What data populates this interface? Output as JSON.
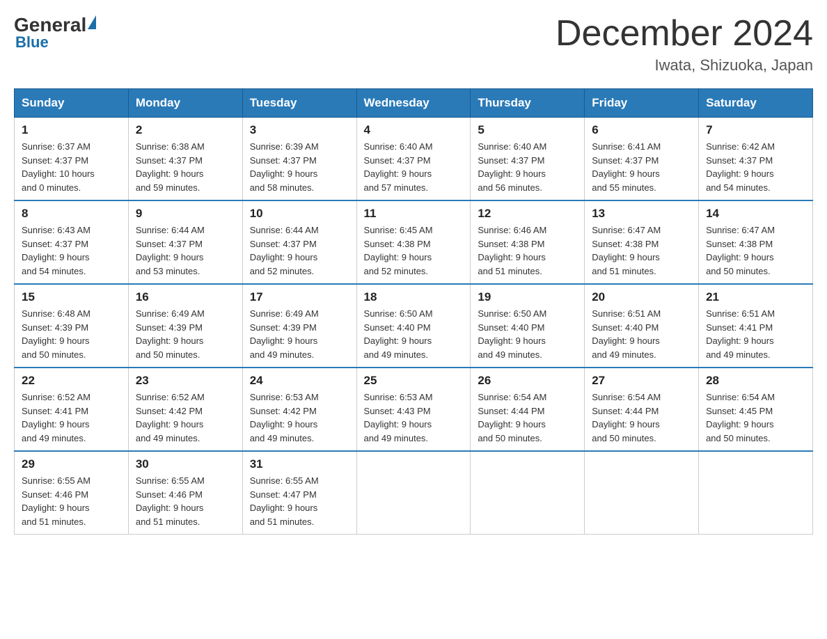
{
  "header": {
    "logo_general": "General",
    "logo_blue": "Blue",
    "title": "December 2024",
    "subtitle": "Iwata, Shizuoka, Japan"
  },
  "days_of_week": [
    "Sunday",
    "Monday",
    "Tuesday",
    "Wednesday",
    "Thursday",
    "Friday",
    "Saturday"
  ],
  "weeks": [
    [
      {
        "day": "1",
        "sunrise": "6:37 AM",
        "sunset": "4:37 PM",
        "daylight": "10 hours and 0 minutes."
      },
      {
        "day": "2",
        "sunrise": "6:38 AM",
        "sunset": "4:37 PM",
        "daylight": "9 hours and 59 minutes."
      },
      {
        "day": "3",
        "sunrise": "6:39 AM",
        "sunset": "4:37 PM",
        "daylight": "9 hours and 58 minutes."
      },
      {
        "day": "4",
        "sunrise": "6:40 AM",
        "sunset": "4:37 PM",
        "daylight": "9 hours and 57 minutes."
      },
      {
        "day": "5",
        "sunrise": "6:40 AM",
        "sunset": "4:37 PM",
        "daylight": "9 hours and 56 minutes."
      },
      {
        "day": "6",
        "sunrise": "6:41 AM",
        "sunset": "4:37 PM",
        "daylight": "9 hours and 55 minutes."
      },
      {
        "day": "7",
        "sunrise": "6:42 AM",
        "sunset": "4:37 PM",
        "daylight": "9 hours and 54 minutes."
      }
    ],
    [
      {
        "day": "8",
        "sunrise": "6:43 AM",
        "sunset": "4:37 PM",
        "daylight": "9 hours and 54 minutes."
      },
      {
        "day": "9",
        "sunrise": "6:44 AM",
        "sunset": "4:37 PM",
        "daylight": "9 hours and 53 minutes."
      },
      {
        "day": "10",
        "sunrise": "6:44 AM",
        "sunset": "4:37 PM",
        "daylight": "9 hours and 52 minutes."
      },
      {
        "day": "11",
        "sunrise": "6:45 AM",
        "sunset": "4:38 PM",
        "daylight": "9 hours and 52 minutes."
      },
      {
        "day": "12",
        "sunrise": "6:46 AM",
        "sunset": "4:38 PM",
        "daylight": "9 hours and 51 minutes."
      },
      {
        "day": "13",
        "sunrise": "6:47 AM",
        "sunset": "4:38 PM",
        "daylight": "9 hours and 51 minutes."
      },
      {
        "day": "14",
        "sunrise": "6:47 AM",
        "sunset": "4:38 PM",
        "daylight": "9 hours and 50 minutes."
      }
    ],
    [
      {
        "day": "15",
        "sunrise": "6:48 AM",
        "sunset": "4:39 PM",
        "daylight": "9 hours and 50 minutes."
      },
      {
        "day": "16",
        "sunrise": "6:49 AM",
        "sunset": "4:39 PM",
        "daylight": "9 hours and 50 minutes."
      },
      {
        "day": "17",
        "sunrise": "6:49 AM",
        "sunset": "4:39 PM",
        "daylight": "9 hours and 49 minutes."
      },
      {
        "day": "18",
        "sunrise": "6:50 AM",
        "sunset": "4:40 PM",
        "daylight": "9 hours and 49 minutes."
      },
      {
        "day": "19",
        "sunrise": "6:50 AM",
        "sunset": "4:40 PM",
        "daylight": "9 hours and 49 minutes."
      },
      {
        "day": "20",
        "sunrise": "6:51 AM",
        "sunset": "4:40 PM",
        "daylight": "9 hours and 49 minutes."
      },
      {
        "day": "21",
        "sunrise": "6:51 AM",
        "sunset": "4:41 PM",
        "daylight": "9 hours and 49 minutes."
      }
    ],
    [
      {
        "day": "22",
        "sunrise": "6:52 AM",
        "sunset": "4:41 PM",
        "daylight": "9 hours and 49 minutes."
      },
      {
        "day": "23",
        "sunrise": "6:52 AM",
        "sunset": "4:42 PM",
        "daylight": "9 hours and 49 minutes."
      },
      {
        "day": "24",
        "sunrise": "6:53 AM",
        "sunset": "4:42 PM",
        "daylight": "9 hours and 49 minutes."
      },
      {
        "day": "25",
        "sunrise": "6:53 AM",
        "sunset": "4:43 PM",
        "daylight": "9 hours and 49 minutes."
      },
      {
        "day": "26",
        "sunrise": "6:54 AM",
        "sunset": "4:44 PM",
        "daylight": "9 hours and 50 minutes."
      },
      {
        "day": "27",
        "sunrise": "6:54 AM",
        "sunset": "4:44 PM",
        "daylight": "9 hours and 50 minutes."
      },
      {
        "day": "28",
        "sunrise": "6:54 AM",
        "sunset": "4:45 PM",
        "daylight": "9 hours and 50 minutes."
      }
    ],
    [
      {
        "day": "29",
        "sunrise": "6:55 AM",
        "sunset": "4:46 PM",
        "daylight": "9 hours and 51 minutes."
      },
      {
        "day": "30",
        "sunrise": "6:55 AM",
        "sunset": "4:46 PM",
        "daylight": "9 hours and 51 minutes."
      },
      {
        "day": "31",
        "sunrise": "6:55 AM",
        "sunset": "4:47 PM",
        "daylight": "9 hours and 51 minutes."
      },
      null,
      null,
      null,
      null
    ]
  ],
  "labels": {
    "sunrise": "Sunrise:",
    "sunset": "Sunset:",
    "daylight": "Daylight:"
  }
}
